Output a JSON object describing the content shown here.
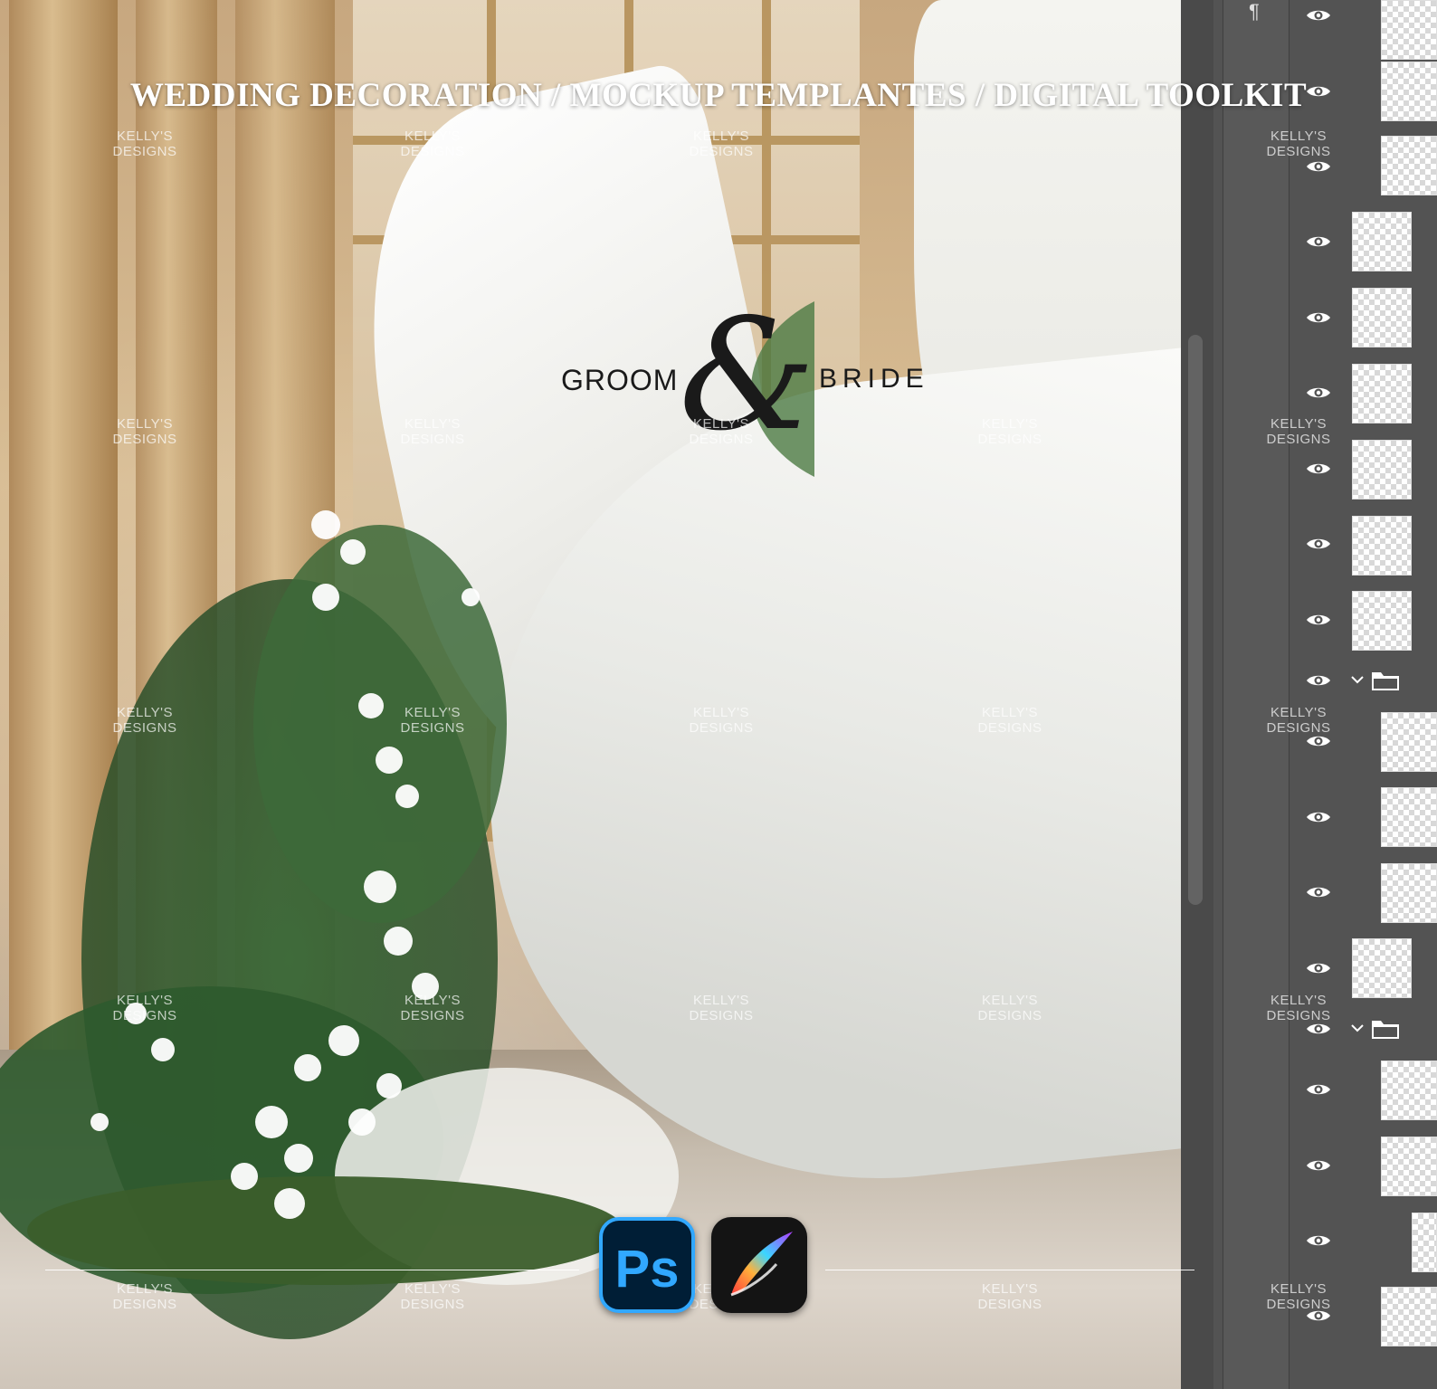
{
  "header": {
    "title": "WEDDING DECORATION  /  MOCKUP TEMPLANTES / DIGITAL TOOLKIT"
  },
  "logo": {
    "groom": "GROOM",
    "ampersand": "&",
    "bride": "BRIDE"
  },
  "watermark": {
    "line1": "KELLY'S",
    "line2": "DESIGNS"
  },
  "apps": {
    "photoshop_label": "Ps"
  },
  "colors": {
    "photoshop_bg": "#001e36",
    "photoshop_accent": "#31a8ff",
    "procreate_bg": "#141414",
    "panel_bg": "#535353"
  },
  "layers_panel": {
    "layers": [
      {
        "icon": "eye-icon"
      },
      {
        "icon": "eye-icon"
      },
      {
        "icon": "eye-icon"
      },
      {
        "icon": "eye-icon"
      },
      {
        "icon": "eye-icon"
      },
      {
        "icon": "eye-icon"
      },
      {
        "icon": "eye-icon"
      },
      {
        "icon": "eye-icon"
      },
      {
        "icon": "eye-icon"
      },
      {
        "icon": "eye-icon",
        "type": "folder"
      },
      {
        "icon": "eye-icon"
      },
      {
        "icon": "eye-icon"
      },
      {
        "icon": "eye-icon"
      },
      {
        "icon": "eye-icon"
      },
      {
        "icon": "eye-icon",
        "type": "folder"
      },
      {
        "icon": "eye-icon"
      },
      {
        "icon": "eye-icon"
      },
      {
        "icon": "eye-icon"
      },
      {
        "icon": "eye-icon"
      }
    ]
  }
}
